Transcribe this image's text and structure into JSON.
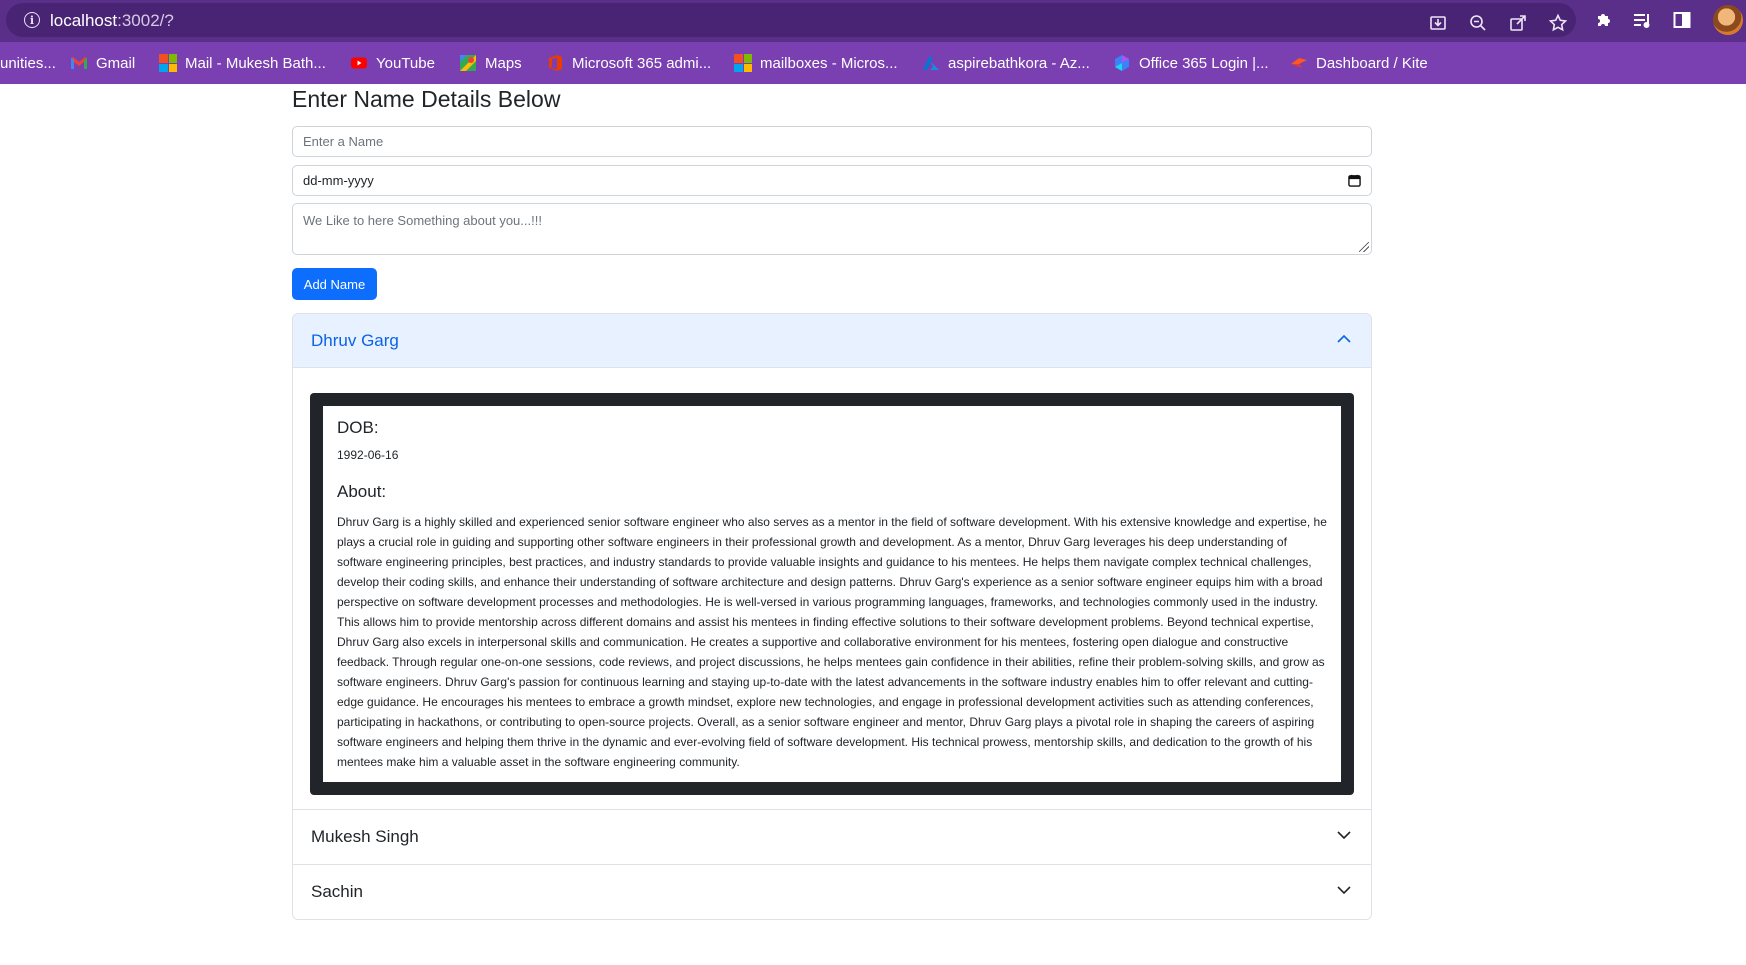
{
  "browser": {
    "url_host": "localhost",
    "url_rest": ":3002/?",
    "bookmarks": [
      {
        "label": "unities...",
        "icon": "none"
      },
      {
        "label": "Gmail",
        "icon": "gmail-icon"
      },
      {
        "label": "Mail - Mukesh Bath...",
        "icon": "microsoft-icon"
      },
      {
        "label": "YouTube",
        "icon": "youtube-icon"
      },
      {
        "label": "Maps",
        "icon": "maps-icon"
      },
      {
        "label": "Microsoft 365 admi...",
        "icon": "office-icon"
      },
      {
        "label": "mailboxes - Micros...",
        "icon": "microsoft-icon"
      },
      {
        "label": "aspirebathkora - Az...",
        "icon": "azure-icon"
      },
      {
        "label": "Office 365 Login |...",
        "icon": "office365-icon"
      },
      {
        "label": "Dashboard / Kite",
        "icon": "kite-icon"
      }
    ]
  },
  "form": {
    "title": "Enter Name Details Below",
    "name_placeholder": "Enter a Name",
    "date_placeholder": "dd-mm-yyyy",
    "about_placeholder": "We Like to here Something about you...!!!",
    "submit_label": "Add Name"
  },
  "accordion": {
    "items": [
      {
        "name": "Dhruv Garg",
        "expanded": true
      },
      {
        "name": "Mukesh Singh",
        "expanded": false
      },
      {
        "name": "Sachin",
        "expanded": false
      }
    ],
    "detail": {
      "dob_label": "DOB:",
      "dob_value": "1992-06-16",
      "about_label": "About:",
      "about_value": "Dhruv Garg is a highly skilled and experienced senior software engineer who also serves as a mentor in the field of software development. With his extensive knowledge and expertise, he plays a crucial role in guiding and supporting other software engineers in their professional growth and development. As a mentor, Dhruv Garg leverages his deep understanding of software engineering principles, best practices, and industry standards to provide valuable insights and guidance to his mentees. He helps them navigate complex technical challenges, develop their coding skills, and enhance their understanding of software architecture and design patterns. Dhruv Garg's experience as a senior software engineer equips him with a broad perspective on software development processes and methodologies. He is well-versed in various programming languages, frameworks, and technologies commonly used in the industry. This allows him to provide mentorship across different domains and assist his mentees in finding effective solutions to their software development problems. Beyond technical expertise, Dhruv Garg also excels in interpersonal skills and communication. He creates a supportive and collaborative environment for his mentees, fostering open dialogue and constructive feedback. Through regular one-on-one sessions, code reviews, and project discussions, he helps mentees gain confidence in their abilities, refine their problem-solving skills, and grow as software engineers. Dhruv Garg's passion for continuous learning and staying up-to-date with the latest advancements in the software industry enables him to offer relevant and cutting-edge guidance. He encourages his mentees to embrace a growth mindset, explore new technologies, and engage in professional development activities such as attending conferences, participating in hackathons, or contributing to open-source projects. Overall, as a senior software engineer and mentor, Dhruv Garg plays a pivotal role in shaping the careers of aspiring software engineers and helping them thrive in the dynamic and ever-evolving field of software development. His technical prowess, mentorship skills, and dedication to the growth of his mentees make him a valuable asset in the software engineering community."
    }
  },
  "colors": {
    "address_bar": "#5a2f8a",
    "bookmarks_bar": "#7a3fb0",
    "primary_button": "#0d6efd",
    "accordion_active_bg": "#e7f1ff",
    "accordion_active_text": "#0c63e4",
    "card_frame": "#212529"
  }
}
